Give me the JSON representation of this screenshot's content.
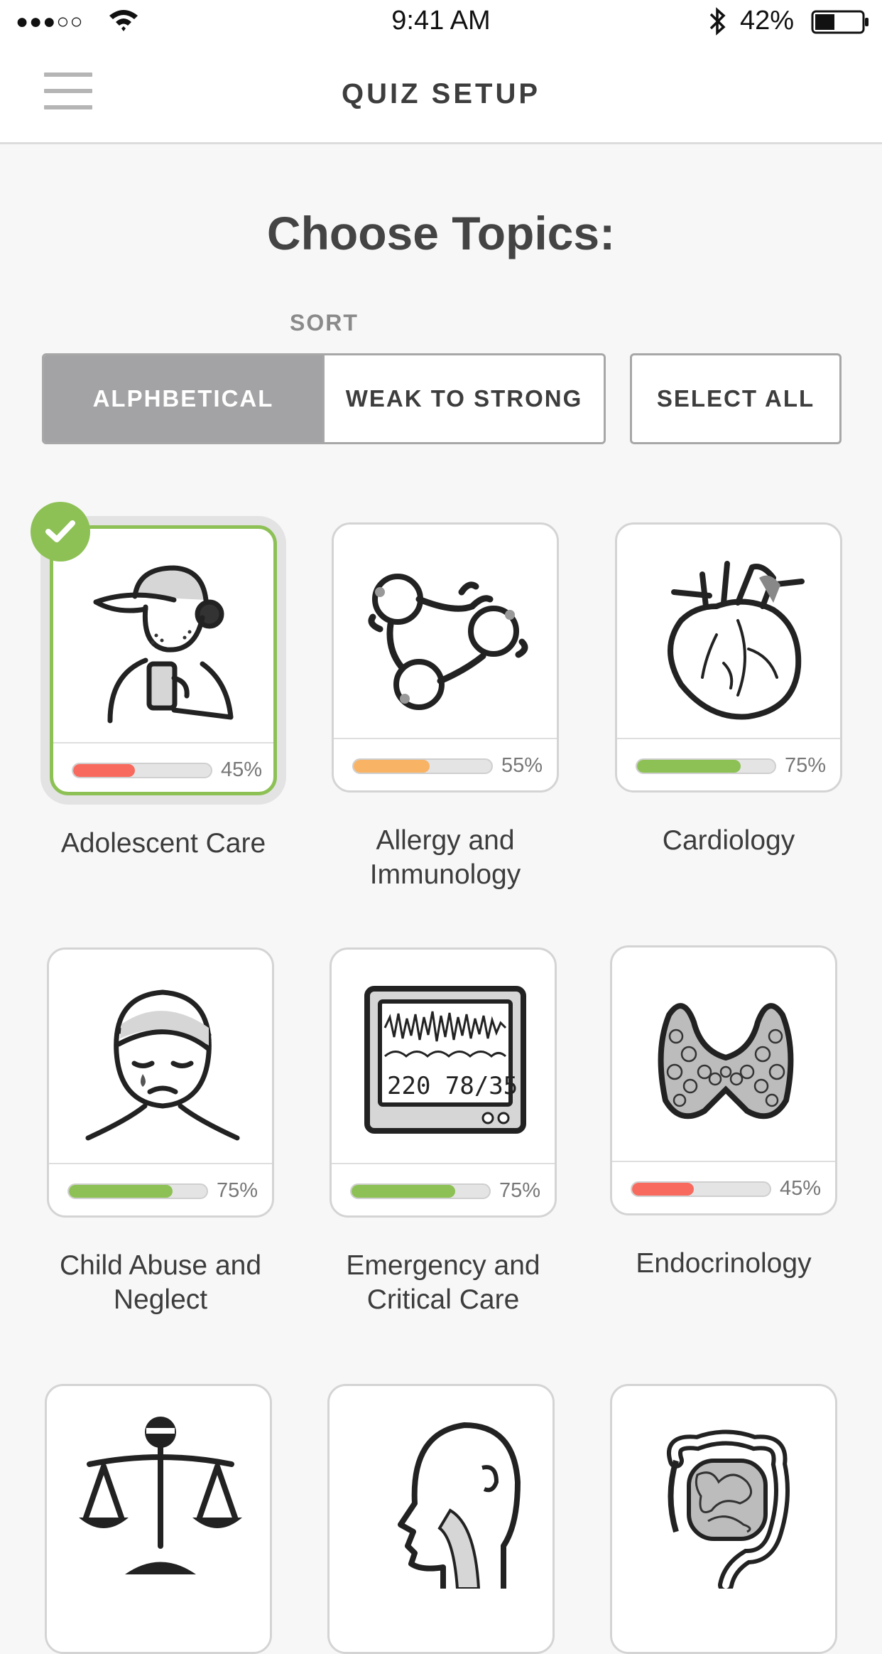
{
  "status_bar": {
    "signal": "●●●○○",
    "time": "9:41 AM",
    "battery": "42%",
    "battery_level": 0.42
  },
  "nav": {
    "title": "QUIZ SETUP",
    "menu_icon": "hamburger-menu-icon"
  },
  "page": {
    "title": "Choose Topics:",
    "sort_label": "SORT",
    "sort_options": [
      "ALPHBETICAL",
      "WEAK TO STRONG"
    ],
    "sort_selected": "ALPHBETICAL",
    "select_all_label": "SELECT ALL"
  },
  "colors": {
    "accent_green": "#8dc155",
    "progress_red": "#f86a5e",
    "progress_orange": "#f8b365",
    "progress_green": "#8dc155"
  },
  "topics": [
    {
      "name": "Adolescent Care",
      "percent_label": "45%",
      "progress": 0.45,
      "color": "#f86a5e",
      "selected": true,
      "icon": "teen-with-phone-icon"
    },
    {
      "name": "Allergy and Immunology",
      "percent_label": "55%",
      "progress": 0.55,
      "color": "#f8b365",
      "selected": false,
      "icon": "antibody-cells-icon"
    },
    {
      "name": "Cardiology",
      "percent_label": "75%",
      "progress": 0.75,
      "color": "#8dc155",
      "selected": false,
      "icon": "heart-icon"
    },
    {
      "name": "Child Abuse and Neglect",
      "percent_label": "75%",
      "progress": 0.75,
      "color": "#8dc155",
      "selected": false,
      "icon": "crying-bandaged-child-icon"
    },
    {
      "name": "Emergency and Critical Care",
      "percent_label": "75%",
      "progress": 0.75,
      "color": "#8dc155",
      "selected": false,
      "icon": "vital-signs-monitor-icon",
      "monitor_text": "220 78/35"
    },
    {
      "name": "Endocrinology",
      "percent_label": "45%",
      "progress": 0.45,
      "color": "#f86a5e",
      "selected": false,
      "icon": "thyroid-gland-icon"
    },
    {
      "name": "",
      "selected": false,
      "icon": "ethics-scale-icon"
    },
    {
      "name": "",
      "selected": false,
      "icon": "head-throat-anatomy-icon"
    },
    {
      "name": "",
      "selected": false,
      "icon": "intestines-icon"
    }
  ]
}
